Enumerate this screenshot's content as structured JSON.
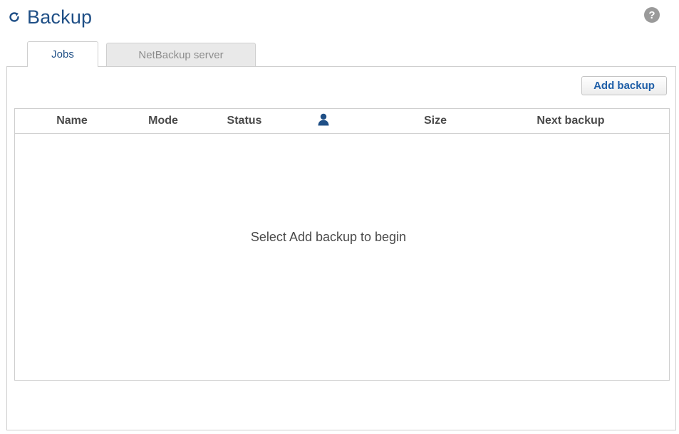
{
  "header": {
    "title": "Backup",
    "title_icon": "refresh-icon",
    "help_icon": "help-icon",
    "help_glyph": "?"
  },
  "tabs": [
    {
      "label": "Jobs",
      "active": true
    },
    {
      "label": "NetBackup server",
      "active": false
    }
  ],
  "toolbar": {
    "add_backup_label": "Add backup"
  },
  "table": {
    "columns": [
      {
        "label": "Name"
      },
      {
        "label": "Mode"
      },
      {
        "label": "Status"
      },
      {
        "label": "",
        "icon": "user-icon"
      },
      {
        "label": "Size"
      },
      {
        "label": "Next backup"
      }
    ],
    "rows": [],
    "empty_message": "Select Add backup to begin"
  },
  "colors": {
    "title": "#1f4f86",
    "accent": "#1f5fa8",
    "border": "#cfcfcf",
    "inactive_tab_bg": "#e9e9e9",
    "user_icon": "#1f4f86"
  }
}
